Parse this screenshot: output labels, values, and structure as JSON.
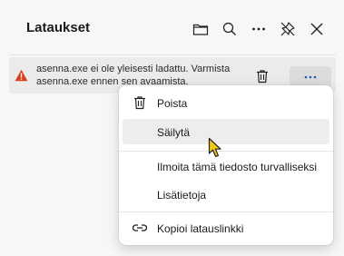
{
  "panel": {
    "title": "Lataukset",
    "header_buttons": [
      {
        "icon": "folder-icon"
      },
      {
        "icon": "search-icon"
      },
      {
        "icon": "more-icon"
      },
      {
        "icon": "unpin-icon"
      },
      {
        "icon": "close-icon"
      }
    ]
  },
  "download_item": {
    "warning_line1": "asenna.exe ei ole yleisesti ladattu. Varmista",
    "warning_line2": "asenna.exe ennen sen avaamista.",
    "warning_color": "#d8401d"
  },
  "context_menu": {
    "items": [
      {
        "label": "Poista",
        "icon": "trash-icon"
      },
      {
        "label": "Säilytä",
        "icon": ""
      },
      {
        "label": "Ilmoita tämä tiedosto turvalliseksi",
        "icon": ""
      },
      {
        "label": "Lisätietoja",
        "icon": ""
      },
      {
        "label": "Kopioi latauslinkki",
        "icon": "link-icon"
      }
    ],
    "hovered": "Säilytä"
  },
  "colors": {
    "panel_bg": "#f7f7f7",
    "item_bg": "#ebebeb",
    "hover_bg": "#ededed",
    "cursor": "#f2c811"
  }
}
